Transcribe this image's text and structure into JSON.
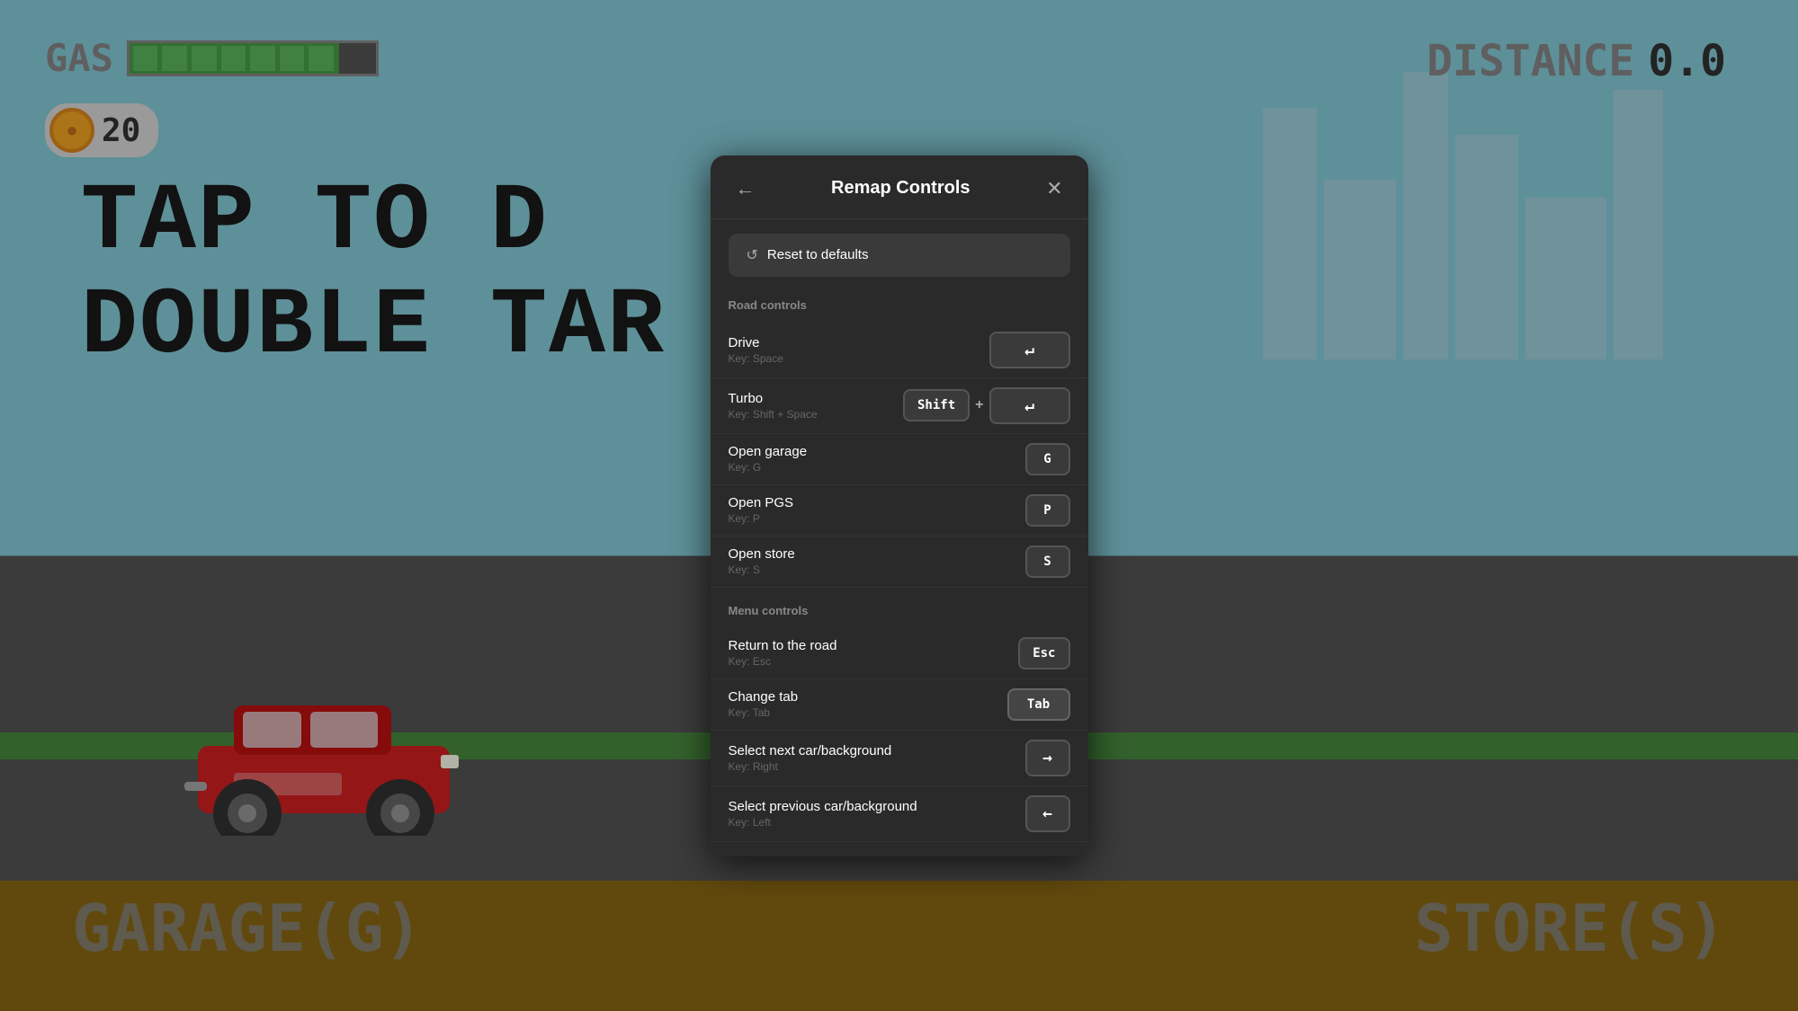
{
  "hud": {
    "gas_label": "GAS",
    "distance_label": "DISTANCE",
    "distance_value": "0.0",
    "coin_count": "20"
  },
  "game_text": {
    "tap_line1": "TAP TO D",
    "tap_line2": "DOUBLE TAR",
    "bottom_garage": "GARAGE(G)",
    "bottom_store": "STORE(S)"
  },
  "modal": {
    "title": "Remap Controls",
    "back_icon": "←",
    "close_icon": "✕",
    "reset_label": "Reset to defaults",
    "reset_icon": "↺",
    "sections": [
      {
        "name": "Road controls",
        "controls": [
          {
            "id": "drive",
            "name": "Drive",
            "key_label": "Key: Space",
            "keys": [
              {
                "label": "↵",
                "type": "enter"
              }
            ]
          },
          {
            "id": "turbo",
            "name": "Turbo",
            "key_label": "Key: Shift + Space",
            "keys": [
              {
                "label": "Shift",
                "type": "normal"
              },
              {
                "plus": true
              },
              {
                "label": "↵",
                "type": "enter"
              }
            ]
          },
          {
            "id": "open_garage",
            "name": "Open garage",
            "key_label": "Key: G",
            "keys": [
              {
                "label": "G",
                "type": "normal"
              }
            ]
          },
          {
            "id": "open_pgs",
            "name": "Open PGS",
            "key_label": "Key: P",
            "keys": [
              {
                "label": "P",
                "type": "normal"
              }
            ]
          },
          {
            "id": "open_store",
            "name": "Open store",
            "key_label": "Key: S",
            "keys": [
              {
                "label": "S",
                "type": "normal"
              }
            ]
          }
        ]
      },
      {
        "name": "Menu controls",
        "controls": [
          {
            "id": "return_road",
            "name": "Return to the road",
            "key_label": "Key: Esc",
            "keys": [
              {
                "label": "Esc",
                "type": "normal"
              }
            ]
          },
          {
            "id": "change_tab",
            "name": "Change tab",
            "key_label": "Key: Tab",
            "keys": [
              {
                "label": "Tab",
                "type": "tab"
              }
            ]
          },
          {
            "id": "next_car",
            "name": "Select next car/background",
            "key_label": "Key: Right",
            "keys": [
              {
                "label": "→",
                "type": "arrow"
              }
            ]
          },
          {
            "id": "prev_car",
            "name": "Select previous car/background",
            "key_label": "Key: Left",
            "keys": [
              {
                "label": "←",
                "type": "arrow"
              }
            ]
          }
        ]
      }
    ]
  }
}
